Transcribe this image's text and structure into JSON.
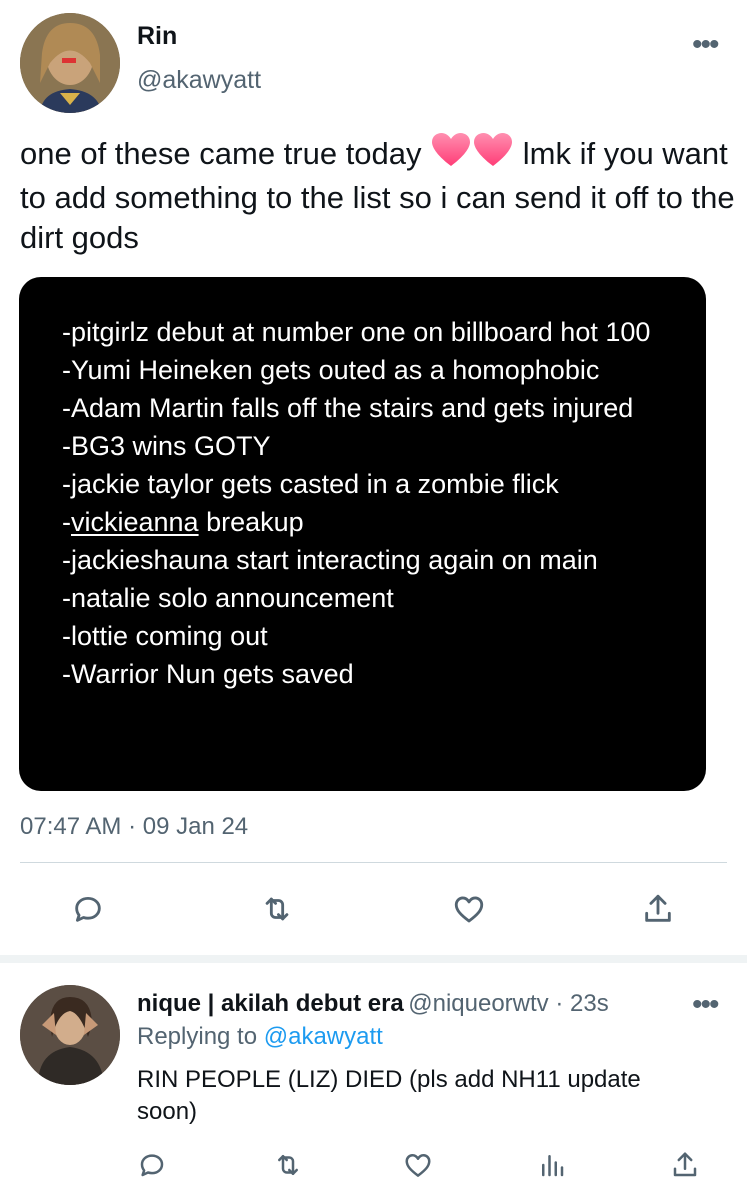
{
  "tweet": {
    "author_name": "Rin",
    "author_handle": "@akawyatt",
    "more_label": "•••",
    "text_part1": "one of these came true today ",
    "text_part2": " lmk if you want to add something to the list so i can send it off to the dirt gods",
    "media_lines": [
      {
        "text": "-pitgirlz debut at number one on billboard hot 100"
      },
      {
        "text": "-Yumi Heineken gets outed as a homophobic"
      },
      {
        "text": "-Adam Martin falls off the stairs and gets injured"
      },
      {
        "text": "-BG3 wins GOTY"
      },
      {
        "text": "-jackie taylor gets casted in a zombie flick"
      },
      {
        "text_prefix": "-",
        "text_underlined": "vickieanna",
        "text_suffix": " breakup"
      },
      {
        "text": "-jackieshauna start interacting again on main"
      },
      {
        "text": "-natalie solo announcement"
      },
      {
        "text": "-lottie coming out"
      },
      {
        "text": "-Warrior Nun gets saved"
      }
    ],
    "time": "07:47 AM",
    "separator": " · ",
    "date": "09 Jan 24",
    "actions": [
      "reply-icon",
      "retweet-icon",
      "like-icon",
      "share-icon"
    ]
  },
  "reply": {
    "author_name": "nique | akilah debut era",
    "author_handle": "@niqueorwtv",
    "time_ago": " · 23s",
    "replying_to_label": "Replying to ",
    "replying_to_handle": "@akawyatt",
    "text": "RIN PEOPLE (LIZ) DIED (pls add NH11 update soon)",
    "more_label": "•••",
    "actions": [
      "reply-icon",
      "retweet-icon",
      "like-icon",
      "analytics-icon",
      "share-icon"
    ]
  },
  "colors": {
    "text": "#0f1419",
    "secondary": "#536471",
    "link": "#1d9bf0",
    "heart": "#ff5c8a",
    "media_bg": "#000000"
  }
}
